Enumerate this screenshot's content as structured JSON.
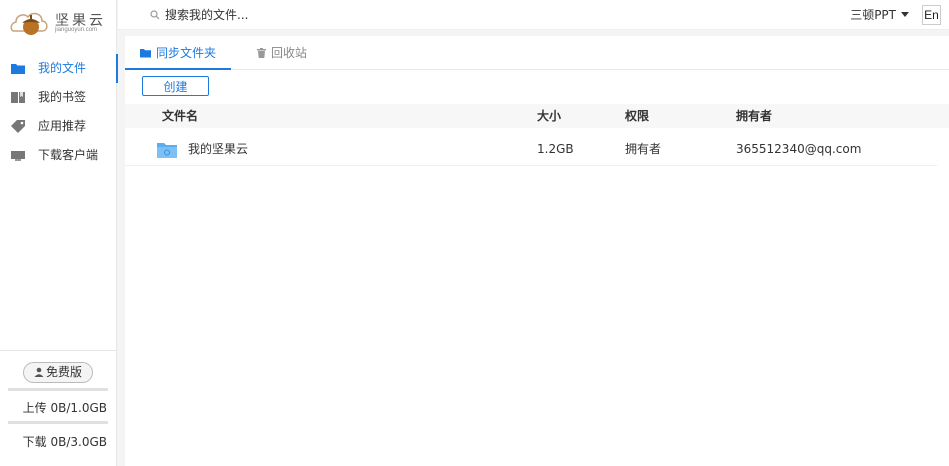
{
  "brand": {
    "name": "坚果云",
    "domain": "jianguoyun.com"
  },
  "sidebar": {
    "items": [
      {
        "label": "我的文件",
        "active": true
      },
      {
        "label": "我的书签",
        "active": false
      },
      {
        "label": "应用推荐",
        "active": false
      },
      {
        "label": "下载客户端",
        "active": false
      }
    ],
    "plan_badge": "免费版",
    "upload_quota": "上传 0B/1.0GB",
    "download_quota": "下载 0B/3.0GB",
    "upload_fraction": 0,
    "download_fraction": 0
  },
  "topbar": {
    "search_placeholder": "搜索我的文件...",
    "user_name": "三顿PPT",
    "language_button": "En"
  },
  "tabs": [
    {
      "label": "同步文件夹",
      "active": true
    },
    {
      "label": "回收站",
      "active": false
    }
  ],
  "create_button": "创建",
  "table": {
    "columns": [
      "文件名",
      "大小",
      "权限",
      "拥有者"
    ],
    "rows": [
      {
        "name": "我的坚果云",
        "size": "1.2GB",
        "permission": "拥有者",
        "owner": "365512340@qq.com"
      }
    ]
  },
  "colors": {
    "accent": "#1d7be0",
    "folder": "#5aaef0"
  }
}
